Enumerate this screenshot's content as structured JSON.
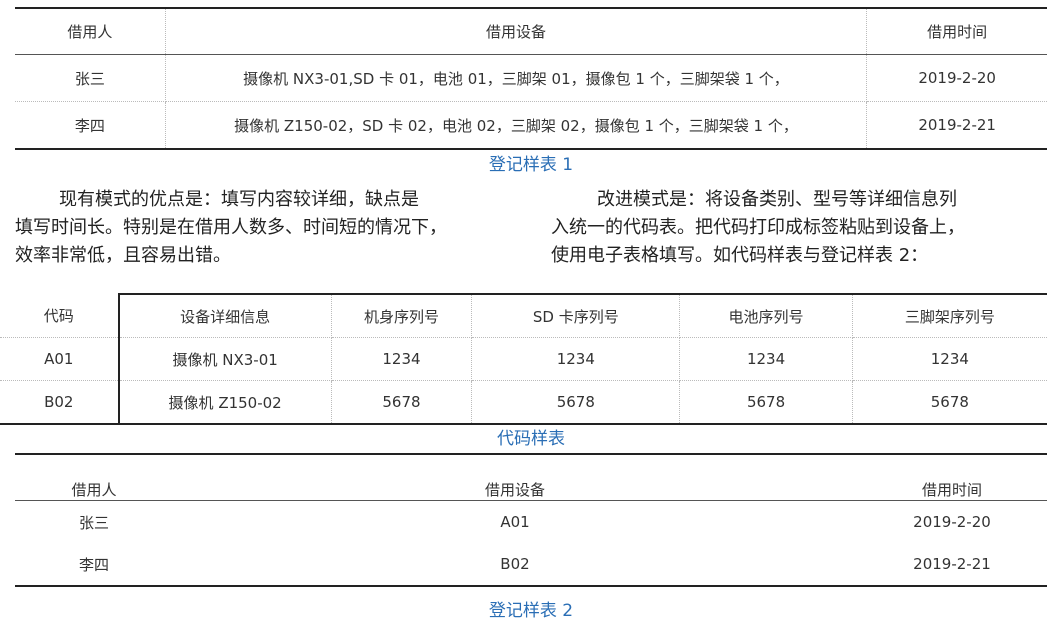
{
  "table1": {
    "headers": [
      "借用人",
      "借用设备",
      "借用时间"
    ],
    "rows": [
      [
        "张三",
        "摄像机 NX3-01,SD 卡 01，电池 01，三脚架 01，摄像包 1 个，三脚架袋 1 个，",
        "2019-2-20"
      ],
      [
        "李四",
        "摄像机 Z150-02，SD 卡 02，电池 02，三脚架 02，摄像包 1 个，三脚架袋 1 个，",
        "2019-2-21"
      ]
    ],
    "caption": "登记样表 1"
  },
  "paragraph_left": {
    "line1": "现有模式的优点是：填写内容较详细，缺点是",
    "line2": "填写时间长。特别是在借用人数多、时间短的情况下，",
    "line3": "效率非常低，且容易出错。"
  },
  "paragraph_right": {
    "line1": "改进模式是：将设备类别、型号等详细信息列",
    "line2": "入统一的代码表。把代码打印成标签粘贴到设备上，",
    "line3": "使用电子表格填写。如代码样表与登记样表 2："
  },
  "table2": {
    "headers": [
      "代码",
      "设备详细信息",
      "机身序列号",
      "SD 卡序列号",
      "电池序列号",
      "三脚架序列号"
    ],
    "rows": [
      [
        "A01",
        "摄像机 NX3-01",
        "1234",
        "1234",
        "1234",
        "1234"
      ],
      [
        "B02",
        "摄像机 Z150-02",
        "5678",
        "5678",
        "5678",
        "5678"
      ]
    ],
    "caption": "代码样表"
  },
  "table3": {
    "headers": [
      "借用人",
      "借用设备",
      "借用时间"
    ],
    "rows": [
      [
        "张三",
        "A01",
        "2019-2-20"
      ],
      [
        "李四",
        "B02",
        "2019-2-21"
      ]
    ],
    "caption": "登记样表 2"
  }
}
